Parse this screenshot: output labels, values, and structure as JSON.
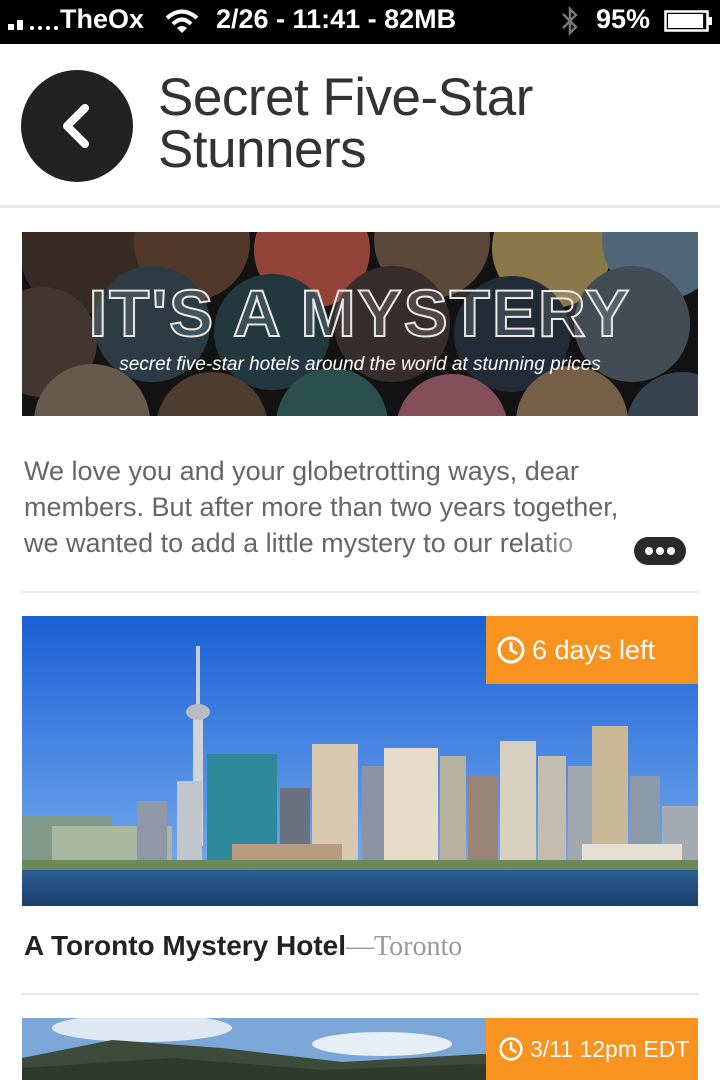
{
  "status_bar": {
    "carrier": "TheOx",
    "center_text": "2/26 - 11:41 - 82MB",
    "battery_percent": "95%",
    "battery_level": 0.95,
    "icons": [
      "signal-icon",
      "wifi-icon",
      "bluetooth-icon",
      "battery-icon"
    ]
  },
  "header": {
    "back_icon": "chevron-left-icon",
    "title_line1": "Secret Five-Star",
    "title_line2": "Stunners"
  },
  "banner": {
    "headline": "IT'S A MYSTERY",
    "subtitle": "secret five-star hotels around the world at stunning prices"
  },
  "intro": {
    "lines": [
      "We love you and your globetrotting ways, dear",
      "members. But after more than two years together,",
      "we wanted to add a little mystery to our relatio"
    ],
    "more_icon": "ellipsis-icon"
  },
  "deals": [
    {
      "badge": "6 days left",
      "badge_icon": "clock-icon",
      "title": "A Toronto Mystery Hotel",
      "separator": "—",
      "location": "Toronto"
    },
    {
      "badge": "3/11 12pm EDT",
      "badge_icon": "clock-icon"
    }
  ],
  "colors": {
    "accent": "#f7931e",
    "status_bar": "#000000",
    "back_button": "#222222",
    "title_text": "#333333",
    "body_text": "#666666"
  }
}
